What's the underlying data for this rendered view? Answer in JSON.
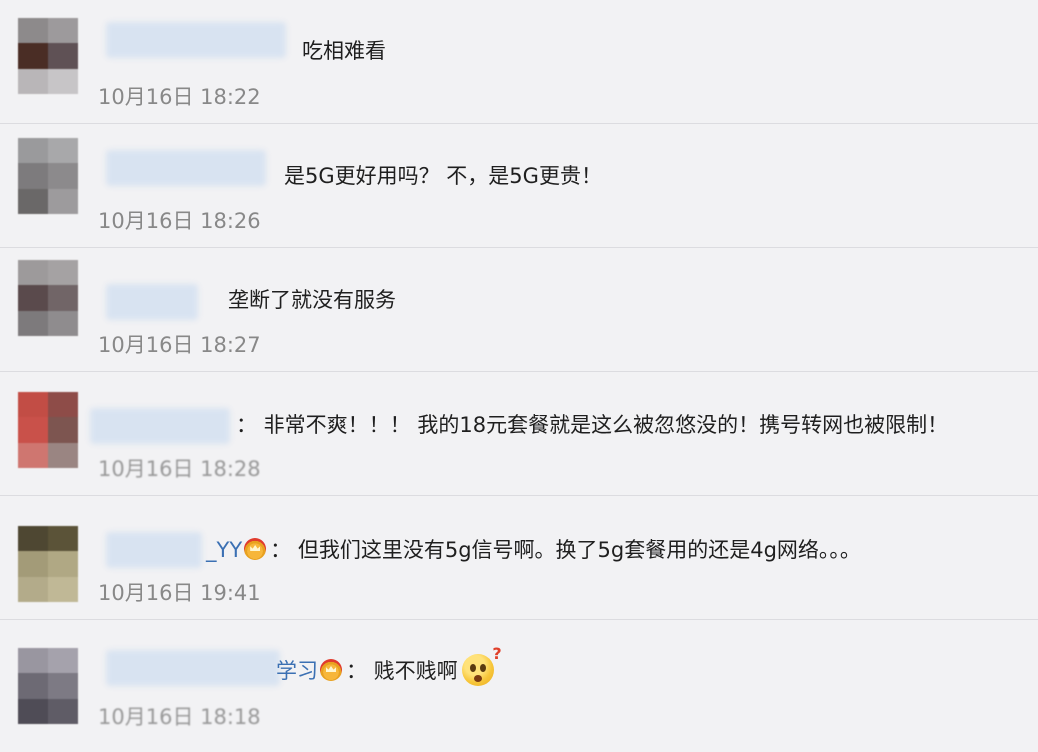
{
  "comments": [
    {
      "text": "吃相难看",
      "time": "10月16日 18:22"
    },
    {
      "text": "是5G更好用吗？ 不，是5G更贵！",
      "time": "10月16日 18:26"
    },
    {
      "text": "垄断了就没有服务",
      "time": "10月16日 18:27"
    },
    {
      "text": "： 非常不爽！！！ 我的18元套餐就是这么被忽悠没的！携号转网也被限制！",
      "time": "10月16日 18:28"
    },
    {
      "username": "_YY",
      "text": "： 但我们这里没有5g信号啊。换了5g套餐用的还是4g网络。。。",
      "time": "10月16日 19:41"
    },
    {
      "username": "学习",
      "text": "： 贱不贱啊",
      "time": "10月16日 18:18"
    }
  ],
  "colors": {
    "background": "#f2f2f4",
    "username": "#3b70b3",
    "timestamp": "#888888",
    "divider": "#dcdce0"
  },
  "icons": {
    "vip_badge": "crown-badge-icon",
    "emoji": "shocked-question-face-icon"
  }
}
